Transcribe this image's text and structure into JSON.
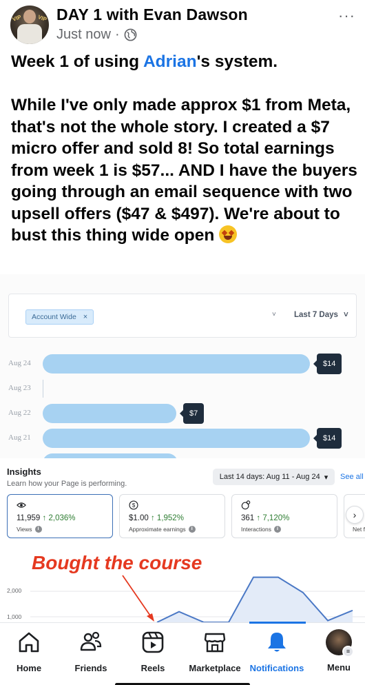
{
  "post": {
    "author_line": "DAY 1 with Evan Dawson",
    "timestamp": "Just now",
    "separator": "·",
    "more": "···",
    "avatar": {
      "left_text": "VIP",
      "right_text": "VIP"
    },
    "text": {
      "line1_before": "Week 1 of using ",
      "mention": "Adrian",
      "line1_after": "'s system.",
      "body": "While I've only made approx $1 from Meta, that's not the whole story. I created a $7 micro offer and sold 8! So total earnings from week 1 is $57... AND I have the buyers going through an email sequence with two upsell offers ($47 & $497). We're about to bust this thing wide open",
      "emoji": "star-struck-emoji"
    }
  },
  "sales_panel": {
    "filter_chip": "Account Wide",
    "chip_close": "×",
    "caret": "˅",
    "range_label": "Last 7 Days",
    "range_caret": "˅",
    "bars": [
      {
        "date": "Aug 24",
        "value": 14,
        "label": "$14"
      },
      {
        "date": "Aug 23",
        "value": 0,
        "label": ""
      },
      {
        "date": "Aug 22",
        "value": 7,
        "label": "$7"
      },
      {
        "date": "Aug 21",
        "value": 14,
        "label": "$14"
      }
    ],
    "bar_max": 14
  },
  "insights": {
    "title": "Insights",
    "subtitle": "Learn how your Page is performing.",
    "date_range": "Last 14 days: Aug 11 - Aug 24",
    "date_caret": "▾",
    "see_all": "See all",
    "metrics": [
      {
        "icon": "eye-icon",
        "value": "11,959",
        "change": "↑ 2,036%",
        "label": "Views",
        "active": true
      },
      {
        "icon": "dollar-icon",
        "value": "$1.00",
        "change": "↑ 1,952%",
        "label": "Approximate earnings",
        "active": false
      },
      {
        "icon": "interactions-icon",
        "value": "361",
        "change": "↑ 7,120%",
        "label": "Interactions",
        "active": false
      }
    ],
    "partial_metric_label": "Net f",
    "next_arrow": "›",
    "annotation": "Bought the course",
    "y_ticks": [
      "2,000",
      "1,000"
    ],
    "chart_data": {
      "type": "area",
      "y_ticks": [
        2000,
        1000
      ],
      "values": [
        0,
        1200,
        650,
        630,
        2550,
        2550,
        1950,
        850,
        1250
      ],
      "color": "#4a78c5"
    }
  },
  "nav": {
    "items": [
      {
        "key": "home",
        "label": "Home"
      },
      {
        "key": "friends",
        "label": "Friends"
      },
      {
        "key": "reels",
        "label": "Reels"
      },
      {
        "key": "marketplace",
        "label": "Marketplace"
      },
      {
        "key": "notifications",
        "label": "Notifications",
        "active": true
      },
      {
        "key": "menu",
        "label": "Menu"
      }
    ],
    "accent": "#1b74e4"
  }
}
